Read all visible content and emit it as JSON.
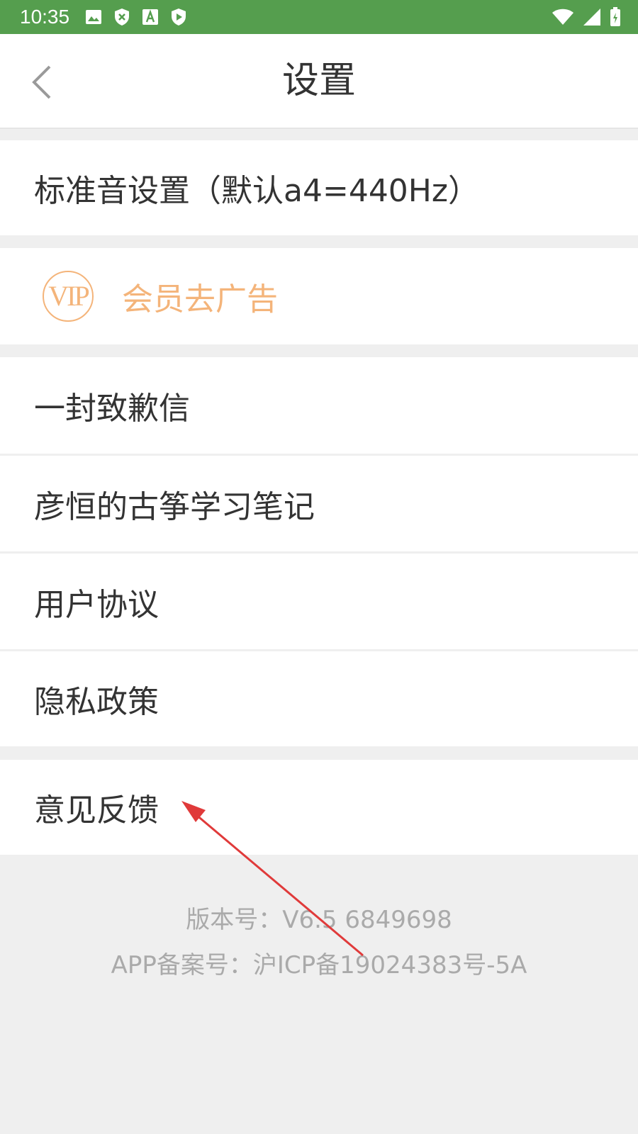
{
  "status_bar": {
    "time": "10:35",
    "left_icons": [
      "image-icon",
      "shield-x-icon",
      "font-download-icon",
      "play-shield-icon"
    ],
    "right_icons": [
      "wifi-icon",
      "cell-signal-icon",
      "battery-icon"
    ],
    "bg_color": "#559e4e"
  },
  "header": {
    "title": "设置",
    "back_icon": "chevron-left-icon"
  },
  "settings": {
    "standard_pitch": "标准音设置（默认a4=440Hz）",
    "vip": {
      "badge": "VIP",
      "label": "会员去广告",
      "color": "#f4b47a"
    },
    "apology_letter": "一封致歉信",
    "study_notes": "彦恒的古筝学习笔记",
    "user_agreement": "用户协议",
    "privacy_policy": "隐私政策",
    "feedback": "意见反馈"
  },
  "footer": {
    "version": "版本号：V6.5  6849698",
    "icp": "APP备案号：沪ICP备19024383号-5A"
  },
  "annotation": {
    "icon": "red-arrow-icon",
    "color": "#e03a3a"
  }
}
